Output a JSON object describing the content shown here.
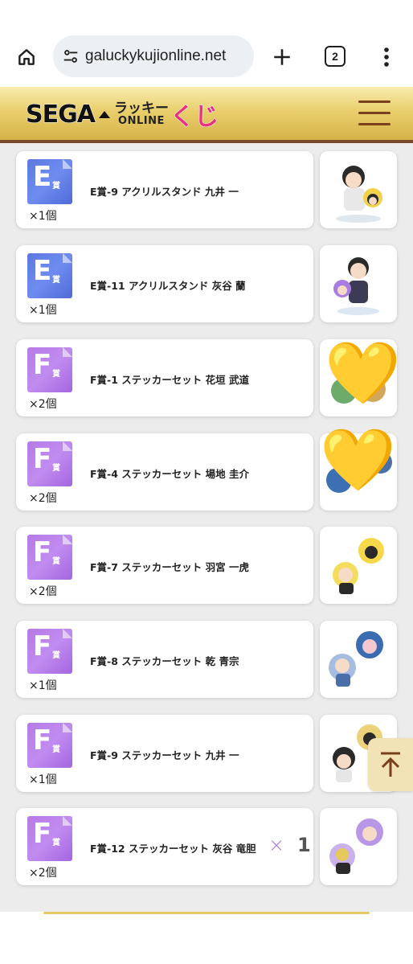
{
  "browser": {
    "url": "galuckykujionline.net",
    "tab_count": "2"
  },
  "header": {
    "logo_sega": "SEGA",
    "logo_lucky": "ラッキー",
    "logo_online": "ONLINE",
    "logo_kuji": "くじ"
  },
  "prizes": [
    {
      "grade": "E",
      "shou": "賞",
      "name": "E賞-9 アクリルスタンド 九井 一",
      "qty": "×1個",
      "color": "#5c78e0"
    },
    {
      "grade": "E",
      "shou": "賞",
      "name": "E賞-11 アクリルスタンド 灰谷 蘭",
      "qty": "×1個",
      "color": "#5c78e0"
    },
    {
      "grade": "F",
      "shou": "賞",
      "name": "F賞-1 ステッカーセット 花垣 武道",
      "qty": "×2個",
      "color": "#b77ae6"
    },
    {
      "grade": "F",
      "shou": "賞",
      "name": "F賞-4 ステッカーセット 場地 圭介",
      "qty": "×2個",
      "color": "#b77ae6"
    },
    {
      "grade": "F",
      "shou": "賞",
      "name": "F賞-7 ステッカーセット 羽宮 一虎",
      "qty": "×2個",
      "color": "#b77ae6"
    },
    {
      "grade": "F",
      "shou": "賞",
      "name": "F賞-8 ステッカーセット 乾 青宗",
      "qty": "×1個",
      "color": "#b77ae6"
    },
    {
      "grade": "F",
      "shou": "賞",
      "name": "F賞-9 ステッカーセット 九井 一",
      "qty": "×1個",
      "color": "#b77ae6"
    },
    {
      "grade": "F",
      "shou": "賞",
      "name": "F賞-12 ステッカーセット 灰谷 竜胆",
      "qty": "×2個",
      "color": "#b77ae6"
    }
  ],
  "overlay": {
    "times_mark": "×",
    "count": "1",
    "heart_emoji": "💛"
  },
  "icons": {
    "home": "home-icon",
    "site_settings": "tune-icon",
    "new_tab": "plus-icon",
    "tab_switcher": "tabs-icon",
    "browser_menu": "more-vert-icon",
    "site_menu": "hamburger-icon",
    "scroll_top": "arrow-up-icon"
  }
}
